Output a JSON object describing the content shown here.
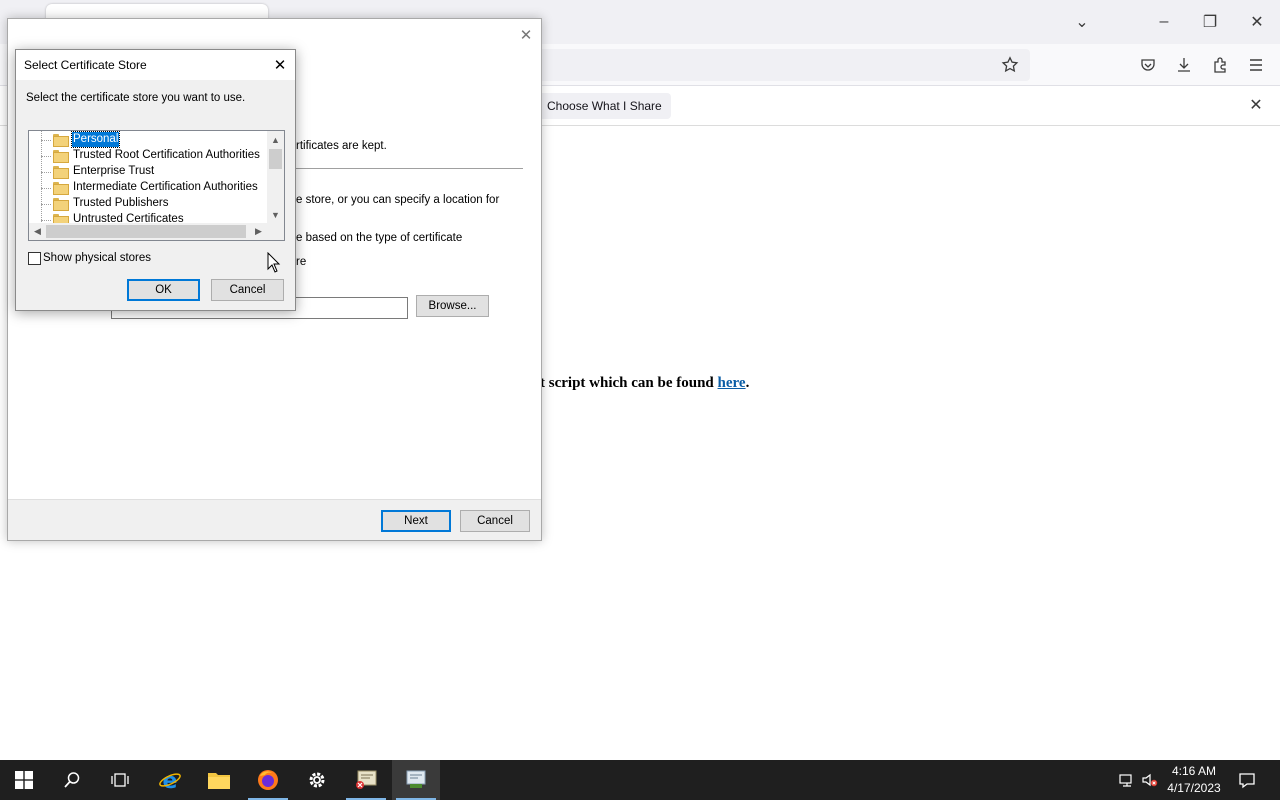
{
  "browser": {
    "notification": {
      "choose_label": "Choose What I Share"
    },
    "page": {
      "text_fragment": "t script which can be found ",
      "link_text": "here",
      "trailing": "."
    }
  },
  "wizard": {
    "text_kept": "rtificates are kept.",
    "text_store": "e store, or you can specify a location for",
    "text_auto": "e based on the type of certificate",
    "text_radio": "re",
    "browse_label": "Browse...",
    "next_label": "Next",
    "cancel_label": "Cancel"
  },
  "dialog": {
    "title": "Select Certificate Store",
    "instruction": "Select the certificate store you want to use.",
    "stores": [
      "Personal",
      "Trusted Root Certification Authorities",
      "Enterprise Trust",
      "Intermediate Certification Authorities",
      "Trusted Publishers",
      "Untrusted Certificates"
    ],
    "selected_store": "Personal",
    "show_physical_label": "Show physical stores",
    "show_physical_checked": false,
    "ok_label": "OK",
    "cancel_label": "Cancel"
  },
  "taskbar": {
    "time": "4:16 AM",
    "date": "4/17/2023",
    "apps": [
      "start",
      "search",
      "task-view",
      "internet-explorer",
      "file-explorer",
      "firefox",
      "settings",
      "certificate-manager",
      "certificate-import-wizard"
    ]
  }
}
